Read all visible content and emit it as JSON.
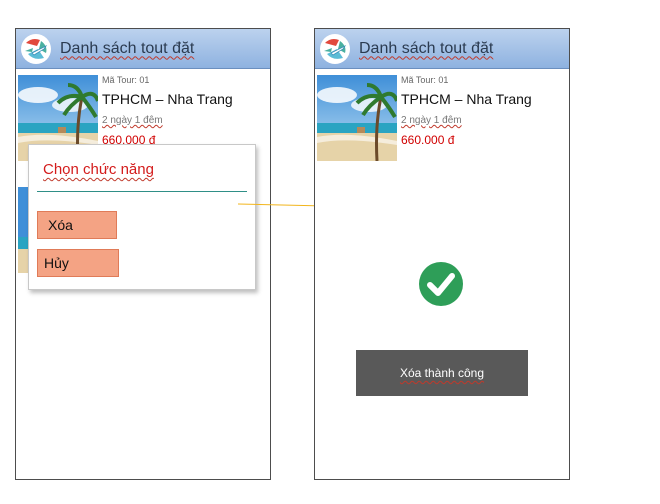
{
  "screens": [
    {
      "header": {
        "title": "Danh sách tout đặt"
      },
      "tour": {
        "code": "Mã Tour: 01",
        "route": "TPHCM – Nha Trang",
        "duration": "2 ngày 1 đêm",
        "price": "660.000 đ"
      },
      "dialog": {
        "title": "Chọn chức năng",
        "delete_label": "Xóa",
        "cancel_label": "Hủy"
      }
    },
    {
      "header": {
        "title": "Danh sách tout đặt"
      },
      "tour": {
        "code": "Mã Tour: 01",
        "route": "TPHCM – Nha Trang",
        "duration": "2 ngày 1 đêm",
        "price": "660.000 đ"
      },
      "success": {
        "toast": "Xóa thành công",
        "icon": "check-circle-icon"
      }
    }
  ],
  "colors": {
    "header_bg": "#a9c4e8",
    "price": "#d10000",
    "dialog_title": "#d41c1c",
    "dialog_button": "#f4a384",
    "toast_bg": "#595959",
    "check_green": "#2e9e58",
    "arrow": "#f2b51c"
  }
}
